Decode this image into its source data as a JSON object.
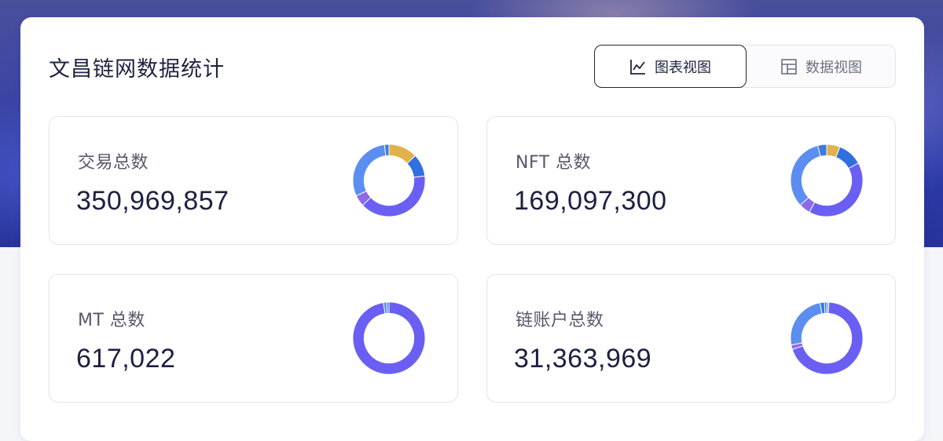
{
  "page": {
    "title": "文昌链网数据统计"
  },
  "view_toggle": {
    "chart_view_label": "图表视图",
    "data_view_label": "数据视图",
    "active": "chart"
  },
  "colors": {
    "accent_purple": "#6a5ff2",
    "blue": "#5b8ef0",
    "mid_blue": "#2f6fe0",
    "gold": "#e2b24a",
    "violet": "#8c6ae8",
    "light_blue": "#7aa8f5",
    "dark_text": "#1c2042"
  },
  "stats": [
    {
      "label": "交易总数",
      "value": "350,969,857",
      "segments": [
        {
          "color": "#e2b24a",
          "fraction": 0.13
        },
        {
          "color": "#2f6fe0",
          "fraction": 0.1
        },
        {
          "color": "#6a5ff2",
          "fraction": 0.4
        },
        {
          "color": "#8c6ae8",
          "fraction": 0.05
        },
        {
          "color": "#5b8ef0",
          "fraction": 0.3
        },
        {
          "color": "#3a7be0",
          "fraction": 0.02
        }
      ]
    },
    {
      "label": "NFT 总数",
      "value": "169,097,300",
      "segments": [
        {
          "color": "#e2b24a",
          "fraction": 0.06
        },
        {
          "color": "#2f6fe0",
          "fraction": 0.11
        },
        {
          "color": "#6a5ff2",
          "fraction": 0.41
        },
        {
          "color": "#8c6ae8",
          "fraction": 0.05
        },
        {
          "color": "#5b8ef0",
          "fraction": 0.33
        },
        {
          "color": "#3a7be0",
          "fraction": 0.04
        }
      ]
    },
    {
      "label": "MT 总数",
      "value": "617,022",
      "segments": [
        {
          "color": "#6a5ff2",
          "fraction": 0.975
        },
        {
          "color": "#5b8ef0",
          "fraction": 0.015
        },
        {
          "color": "#3a7be0",
          "fraction": 0.01
        }
      ]
    },
    {
      "label": "链账户总数",
      "value": "31,363,969",
      "segments": [
        {
          "color": "#7aa8f5",
          "fraction": 0.01
        },
        {
          "color": "#6a5ff2",
          "fraction": 0.69
        },
        {
          "color": "#8c6ae8",
          "fraction": 0.02
        },
        {
          "color": "#5b8ef0",
          "fraction": 0.25
        },
        {
          "color": "#3a7be0",
          "fraction": 0.02
        },
        {
          "color": "#2f6fe0",
          "fraction": 0.01
        }
      ]
    }
  ]
}
